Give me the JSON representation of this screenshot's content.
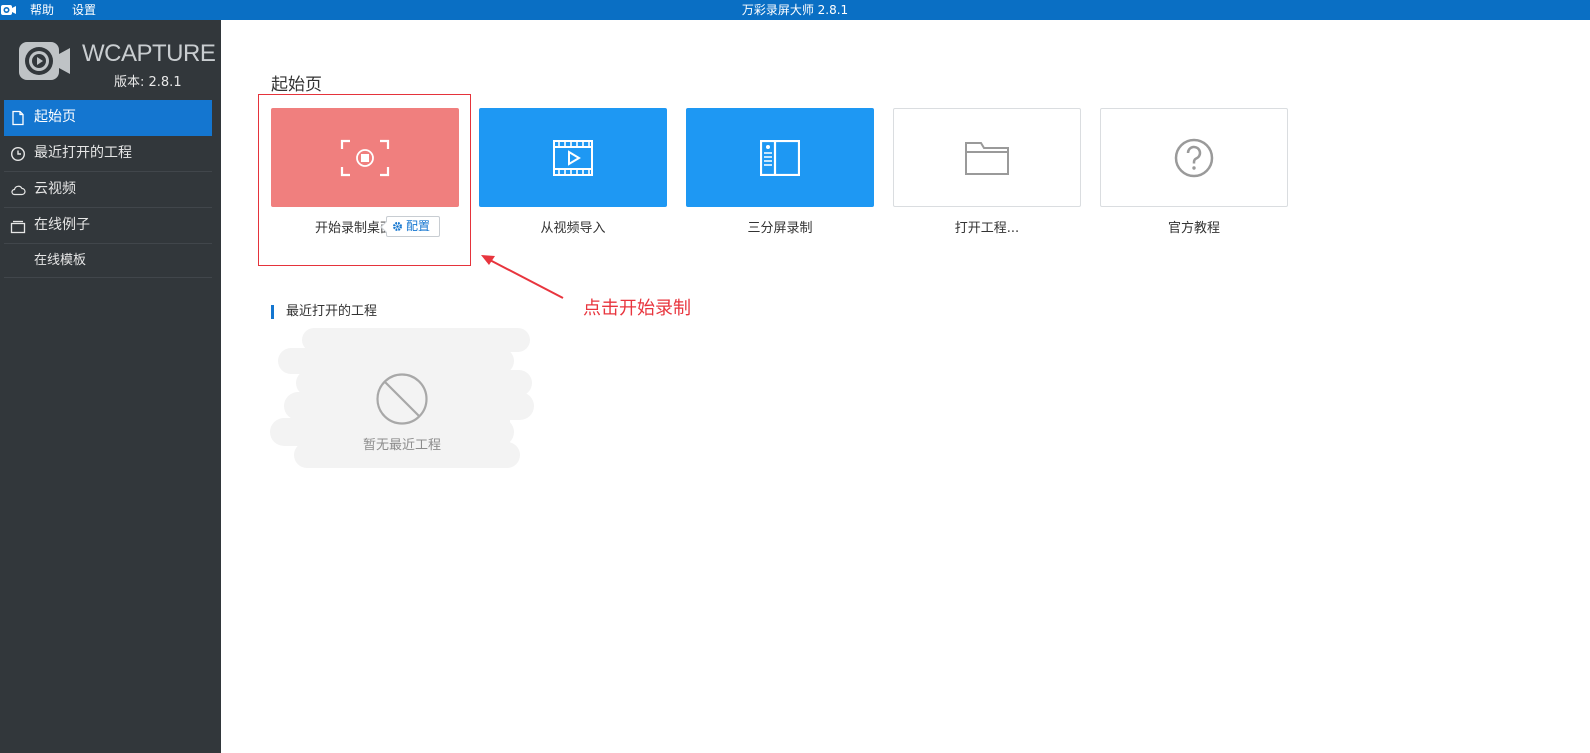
{
  "titlebar": {
    "menu_help": "帮助",
    "menu_settings": "设置",
    "window_title": "万彩录屏大师 2.8.1",
    "bg_color": "#0a6fc4"
  },
  "sidebar": {
    "brand_name": "WCAPTURE",
    "version": "版本: 2.8.1",
    "items": [
      {
        "label": "起始页",
        "icon": "document-icon",
        "active": true
      },
      {
        "label": "最近打开的工程",
        "icon": "clock-icon"
      },
      {
        "label": "云视频",
        "icon": "cloud-icon"
      },
      {
        "label": "在线例子",
        "icon": "stack-icon"
      },
      {
        "label": "在线模板",
        "icon": ""
      }
    ]
  },
  "main": {
    "section_title": "起始页",
    "tiles": [
      {
        "label": "开始录制桌面",
        "icon": "record-screen-icon",
        "color": "#f07f7e"
      },
      {
        "label": "从视频导入",
        "icon": "film-play-icon",
        "color": "#1e98f3"
      },
      {
        "label": "三分屏录制",
        "icon": "split-screen-icon",
        "color": "#1e98f3"
      },
      {
        "label": "打开工程...",
        "icon": "folder-icon",
        "color": "#ffffff"
      },
      {
        "label": "官方教程",
        "icon": "help-circle-icon",
        "color": "#ffffff"
      }
    ],
    "config_label": "配置",
    "annotation": "点击开始录制",
    "recent_title": "最近打开的工程",
    "empty_text": "暂无最近工程"
  },
  "colors": {
    "accent": "#1476d0",
    "sidebar_bg": "#32373b",
    "annotation": "#e8353e"
  }
}
